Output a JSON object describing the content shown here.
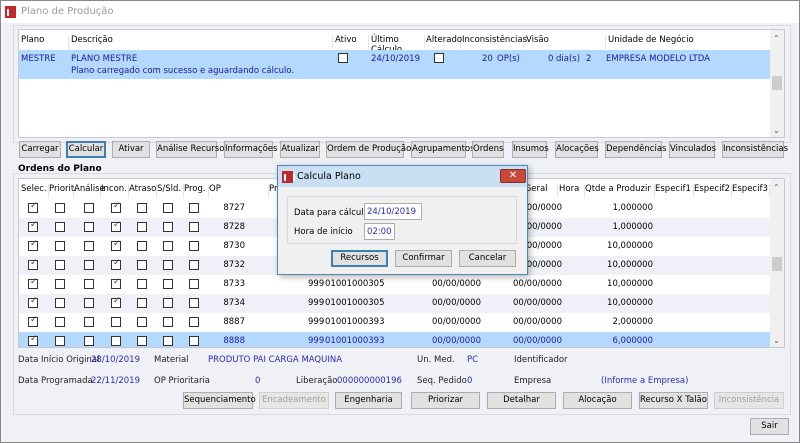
{
  "window": {
    "title": "Plano de Produção"
  },
  "plans": {
    "columns": [
      "Plano",
      "Descrição",
      "Ativo",
      "Último Cálculo",
      "Alterado",
      "Inconsistências",
      "Visão",
      "Unidade de Negócio"
    ],
    "row": {
      "plano": "MESTRE",
      "descricao": "PLANO MESTRE",
      "mensagem": "Plano carregado com sucesso e aguardando cálculo.",
      "ativo": false,
      "ultimo_calculo": "24/10/2019",
      "alterado": false,
      "inconsistencias": "20",
      "inconsistencias_unit": "OP(s)",
      "visao": "0",
      "visao_unit": "dia(s)",
      "unidade_codigo": "2",
      "unidade_nome": "EMPRESA MODELO LTDA"
    }
  },
  "toolbar": [
    "Carregar",
    "Calcular",
    "Ativar",
    "Análise Recurso",
    "Informações",
    "Atualizar",
    "Ordem de Produção",
    "Agrupamentos",
    "Ordens",
    "Insumos",
    "Alocações",
    "Dependências",
    "Vinculados",
    "Inconsistências"
  ],
  "orders": {
    "title": "Ordens do Plano",
    "columns": [
      "Selec.",
      "Priorit.",
      "Análise",
      "Incon.",
      "Atraso",
      "S/Sld.",
      "Prog.",
      "OP",
      "Pri",
      "ino Geral",
      "Hora",
      "Qtde a Produzir",
      "Especif1",
      "Especif2",
      "Especif3"
    ],
    "rows": [
      {
        "selec": true,
        "priorit": false,
        "analise": false,
        "incon": true,
        "atraso": false,
        "ssld": false,
        "prog": false,
        "op": "8727",
        "prior": "",
        "material": "",
        "data": "",
        "termino": "00/0000",
        "qtde": "1,000000"
      },
      {
        "selec": true,
        "priorit": false,
        "analise": false,
        "incon": true,
        "atraso": false,
        "ssld": false,
        "prog": false,
        "op": "8728",
        "prior": "",
        "material": "",
        "data": "",
        "termino": "00/0000",
        "qtde": "1,000000"
      },
      {
        "selec": true,
        "priorit": false,
        "analise": false,
        "incon": true,
        "atraso": false,
        "ssld": false,
        "prog": false,
        "op": "8730",
        "prior": "",
        "material": "",
        "data": "",
        "termino": "00/0000",
        "qtde": "10,000000"
      },
      {
        "selec": true,
        "priorit": false,
        "analise": false,
        "incon": true,
        "atraso": false,
        "ssld": false,
        "prog": false,
        "op": "8732",
        "prior": "",
        "material": "",
        "data": "",
        "termino": "00/0000",
        "qtde": "10,000000"
      },
      {
        "selec": true,
        "priorit": false,
        "analise": false,
        "incon": true,
        "atraso": false,
        "ssld": false,
        "prog": false,
        "op": "8733",
        "prior": "999",
        "material": "01001000305",
        "data": "00/00/0000",
        "termino": "00/00/0000",
        "qtde": "10,000000"
      },
      {
        "selec": true,
        "priorit": false,
        "analise": false,
        "incon": true,
        "atraso": false,
        "ssld": false,
        "prog": false,
        "op": "8734",
        "prior": "999",
        "material": "01001000305",
        "data": "00/00/0000",
        "termino": "00/00/0000",
        "qtde": "10,000000"
      },
      {
        "selec": true,
        "priorit": false,
        "analise": false,
        "incon": false,
        "atraso": false,
        "ssld": false,
        "prog": false,
        "op": "8887",
        "prior": "999",
        "material": "01001000393",
        "data": "00/00/0000",
        "termino": "00/00/0000",
        "qtde": "2,000000"
      },
      {
        "selec": true,
        "priorit": false,
        "analise": false,
        "incon": false,
        "atraso": false,
        "ssld": false,
        "prog": false,
        "op": "8888",
        "prior": "999",
        "material": "01001000393",
        "data": "00/00/0000",
        "termino": "00/00/0000",
        "qtde": "6,000000",
        "selected": true
      }
    ]
  },
  "details": {
    "data_inicio_label": "Data Início Original",
    "data_inicio": "28/10/2019",
    "material_label": "Material",
    "material": "PRODUTO PAI CARGA MAQUINA",
    "unmed_label": "Un. Med.",
    "unmed": "PC",
    "identificador_label": "Identificador",
    "data_prog_label": "Data Programada",
    "data_prog": "22/11/2019",
    "op_prior_label": "OP Prioritaria",
    "op_prior": "0",
    "liberacao_label": "Liberação",
    "liberacao": "000000000196",
    "seq_label": "Seq. Pedido",
    "seq": "0",
    "empresa_label": "Empresa",
    "empresa": "(Informe a Empresa)"
  },
  "actions": [
    "Sequenciamento",
    "Encadeamento",
    "Engenharia",
    "Priorizar",
    "Detalhar",
    "Alocação",
    "Recurso X Talão",
    "Inconsistência"
  ],
  "exit_label": "Sair",
  "dialog": {
    "title": "Calcula Plano",
    "close": "✕",
    "data_label": "Data para cálculo",
    "data": "24/10/2019",
    "hora_label": "Hora de início",
    "hora": "02:00",
    "recursos": "Recursos",
    "confirmar": "Confirmar",
    "cancelar": "Cancelar"
  }
}
